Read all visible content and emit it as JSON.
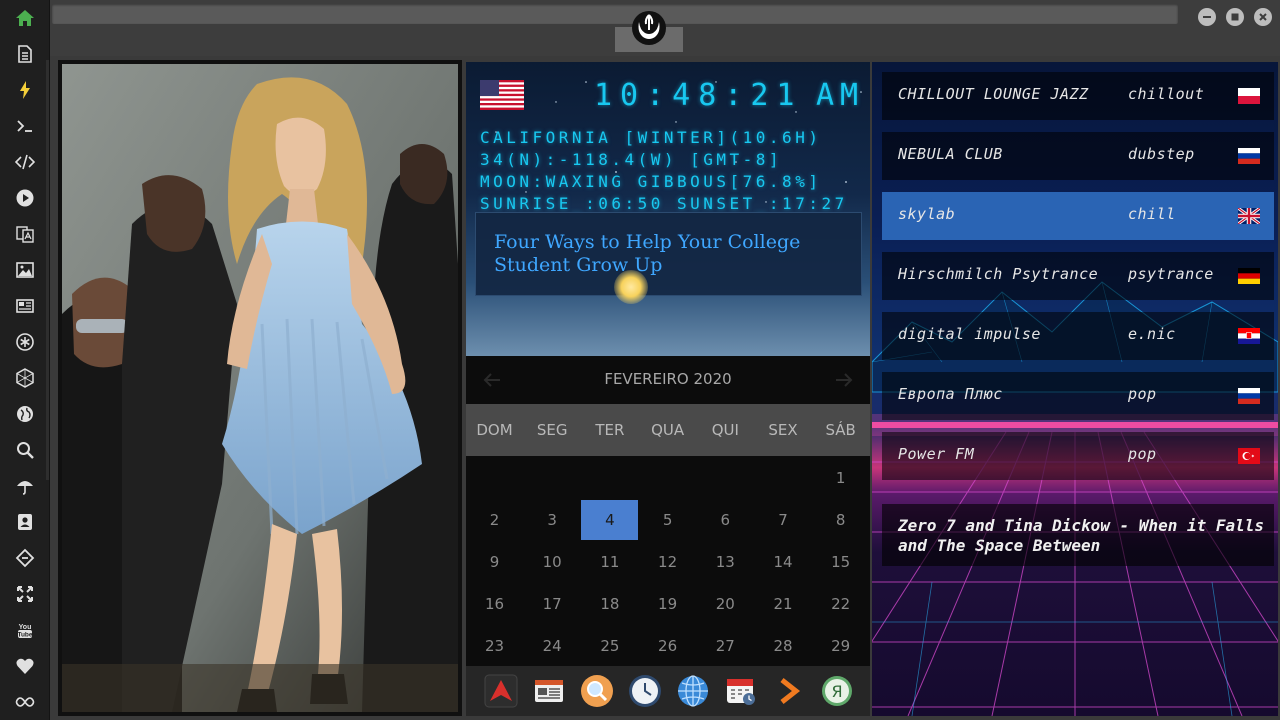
{
  "sidebar": {
    "items": [
      {
        "icon": "home-icon",
        "color": "#4caf50"
      },
      {
        "icon": "document-icon"
      },
      {
        "icon": "bolt-icon",
        "color": "#f5d03a"
      },
      {
        "icon": "terminal-icon"
      },
      {
        "icon": "code-icon"
      },
      {
        "icon": "play-icon"
      },
      {
        "icon": "translate-icon"
      },
      {
        "icon": "image-icon"
      },
      {
        "icon": "newspaper-icon"
      },
      {
        "icon": "asterisk-icon"
      },
      {
        "icon": "hexagon-icon"
      },
      {
        "icon": "globe-icon"
      },
      {
        "icon": "search-icon"
      },
      {
        "icon": "umbrella-icon"
      },
      {
        "icon": "contact-icon"
      },
      {
        "icon": "diamond-link-icon"
      },
      {
        "icon": "expand-icon"
      },
      {
        "icon": "youtube-icon"
      },
      {
        "icon": "heart-icon"
      },
      {
        "icon": "infinity-icon"
      }
    ]
  },
  "topbar": {
    "emblem": "rebel-alliance-emblem-icon",
    "window_buttons": [
      "minimize-icon",
      "maximize-icon",
      "close-icon"
    ]
  },
  "clock": {
    "flag": "usa-flag-icon",
    "time": "10:48:21",
    "ampm": "AM",
    "location": "CALIFORNIA [WINTER](10.6H)",
    "coordinates": "34(N):-118.4(W) [GMT-8]",
    "moon": "MOON:WAXING GIBBOUS[76.8%]",
    "sun": "SUNRISE_:06:50 SUNSET_:17:27"
  },
  "news": {
    "title": "Four Ways to Help Your College Student Grow Up"
  },
  "calendar": {
    "month": "FEVEREIRO 2020",
    "weekdays": [
      "DOM",
      "SEG",
      "TER",
      "QUA",
      "QUI",
      "SEX",
      "SÁB"
    ],
    "first_weekday_index": 6,
    "days": [
      "1",
      "2",
      "3",
      "4",
      "5",
      "6",
      "7",
      "8",
      "9",
      "10",
      "11",
      "12",
      "13",
      "14",
      "15",
      "16",
      "17",
      "18",
      "19",
      "20",
      "21",
      "22",
      "23",
      "24",
      "25",
      "26",
      "27",
      "28",
      "29"
    ],
    "today": "4"
  },
  "dock": {
    "icons": [
      "arrow-app-icon",
      "news-app-icon",
      "search-app-icon",
      "clock-app-icon",
      "globe-app-icon",
      "calendar-app-icon",
      "forward-app-icon",
      "yandex-app-icon"
    ]
  },
  "radio": {
    "stations": [
      {
        "name": "CHILLOUT LOUNGE JAZZ",
        "genre": "chillout",
        "flag": "poland-flag-icon"
      },
      {
        "name": "NEBULA CLUB",
        "genre": "dubstep",
        "flag": "russia-flag-icon"
      },
      {
        "name": "skylab",
        "genre": "chill",
        "flag": "uk-flag-icon",
        "active": true
      },
      {
        "name": "Hirschmilch Psytrance",
        "genre": "psytrance",
        "flag": "germany-flag-icon"
      },
      {
        "name": "digital impulse",
        "genre": "e.nic",
        "flag": "croatia-flag-icon"
      },
      {
        "name": "Европа Плюс",
        "genre": "pop",
        "flag": "russia-flag-icon"
      },
      {
        "name": "Power FM",
        "genre": "pop",
        "flag": "turkey-flag-icon"
      }
    ],
    "now_playing": "Zero 7 and Tina Dickow - When it Falls and The Space Between"
  }
}
